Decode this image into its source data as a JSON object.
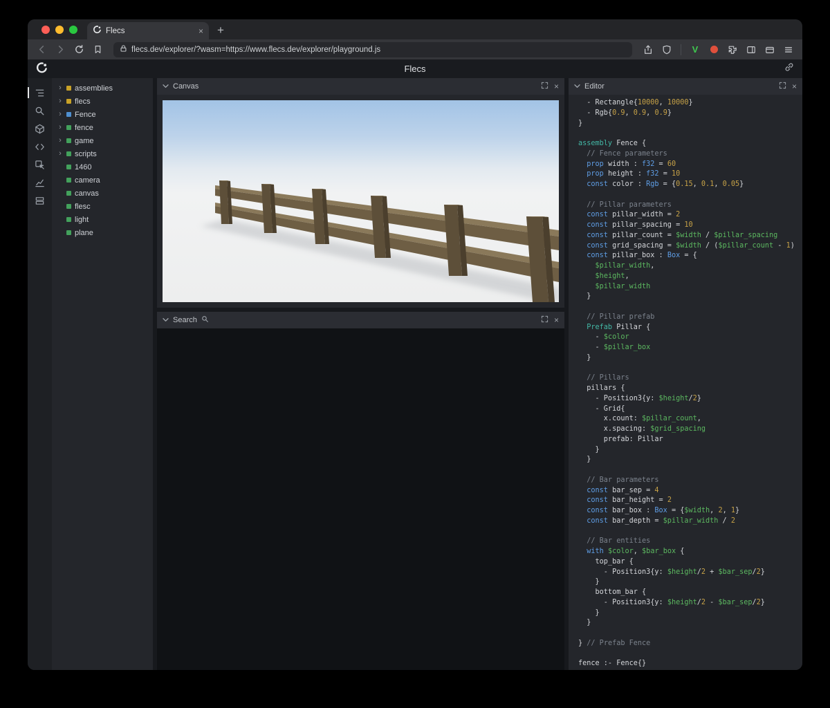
{
  "browser": {
    "tab_title": "Flecs",
    "url": "flecs.dev/explorer/?wasm=https://www.flecs.dev/explorer/playground.js"
  },
  "page": {
    "title": "Flecs"
  },
  "panels": {
    "canvas": {
      "title": "Canvas"
    },
    "search": {
      "title": "Search"
    },
    "editor": {
      "title": "Editor"
    }
  },
  "tree": {
    "type_colors": {
      "module": "#c9a227",
      "prefab": "#4f8fd0",
      "entity": "#43a15c"
    },
    "items": [
      {
        "label": "assemblies",
        "type": "module",
        "expandable": true
      },
      {
        "label": "flecs",
        "type": "module",
        "expandable": true
      },
      {
        "label": "Fence",
        "type": "prefab",
        "expandable": true
      },
      {
        "label": "fence",
        "type": "entity",
        "expandable": true
      },
      {
        "label": "game",
        "type": "entity",
        "expandable": true
      },
      {
        "label": "scripts",
        "type": "entity",
        "expandable": true
      },
      {
        "label": "1460",
        "type": "entity",
        "expandable": false
      },
      {
        "label": "camera",
        "type": "entity",
        "expandable": false
      },
      {
        "label": "canvas",
        "type": "entity",
        "expandable": false
      },
      {
        "label": "flesc",
        "type": "entity",
        "expandable": false
      },
      {
        "label": "light",
        "type": "entity",
        "expandable": false
      },
      {
        "label": "plane",
        "type": "entity",
        "expandable": false
      }
    ]
  },
  "editor": {
    "token_colors": {
      "k": "#5f9ee6",
      "a": "#43b8a6",
      "t": "#5f9ee6",
      "v": "#5cb860",
      "n": "#c7a247",
      "c": "#7b828c",
      "p": "#d4d6da"
    },
    "lines": [
      [
        [
          "p",
          "  - Rectangle{"
        ],
        [
          "n",
          "10000"
        ],
        [
          "p",
          ", "
        ],
        [
          "n",
          "10000"
        ],
        [
          "p",
          "}"
        ]
      ],
      [
        [
          "p",
          "  - Rgb{"
        ],
        [
          "n",
          "0.9"
        ],
        [
          "p",
          ", "
        ],
        [
          "n",
          "0.9"
        ],
        [
          "p",
          ", "
        ],
        [
          "n",
          "0.9"
        ],
        [
          "p",
          "}"
        ]
      ],
      [
        [
          "p",
          "}"
        ]
      ],
      [],
      [
        [
          "a",
          "assembly"
        ],
        [
          "p",
          " Fence {"
        ]
      ],
      [
        [
          "c",
          "  // Fence parameters"
        ]
      ],
      [
        [
          "k",
          "  prop"
        ],
        [
          "p",
          " width : "
        ],
        [
          "t",
          "f32"
        ],
        [
          "p",
          " = "
        ],
        [
          "n",
          "60"
        ]
      ],
      [
        [
          "k",
          "  prop"
        ],
        [
          "p",
          " height : "
        ],
        [
          "t",
          "f32"
        ],
        [
          "p",
          " = "
        ],
        [
          "n",
          "10"
        ]
      ],
      [
        [
          "k",
          "  const"
        ],
        [
          "p",
          " color : "
        ],
        [
          "t",
          "Rgb"
        ],
        [
          "p",
          " = {"
        ],
        [
          "n",
          "0.15"
        ],
        [
          "p",
          ", "
        ],
        [
          "n",
          "0.1"
        ],
        [
          "p",
          ", "
        ],
        [
          "n",
          "0.05"
        ],
        [
          "p",
          "}"
        ]
      ],
      [],
      [
        [
          "c",
          "  // Pillar parameters"
        ]
      ],
      [
        [
          "k",
          "  const"
        ],
        [
          "p",
          " pillar_width = "
        ],
        [
          "n",
          "2"
        ]
      ],
      [
        [
          "k",
          "  const"
        ],
        [
          "p",
          " pillar_spacing = "
        ],
        [
          "n",
          "10"
        ]
      ],
      [
        [
          "k",
          "  const"
        ],
        [
          "p",
          " pillar_count = "
        ],
        [
          "v",
          "$width"
        ],
        [
          "p",
          " / "
        ],
        [
          "v",
          "$pillar_spacing"
        ]
      ],
      [
        [
          "k",
          "  const"
        ],
        [
          "p",
          " grid_spacing = "
        ],
        [
          "v",
          "$width"
        ],
        [
          "p",
          " / ("
        ],
        [
          "v",
          "$pillar_count"
        ],
        [
          "p",
          " - "
        ],
        [
          "n",
          "1"
        ],
        [
          "p",
          ")"
        ]
      ],
      [
        [
          "k",
          "  const"
        ],
        [
          "p",
          " pillar_box : "
        ],
        [
          "t",
          "Box"
        ],
        [
          "p",
          " = {"
        ]
      ],
      [
        [
          "p",
          "    "
        ],
        [
          "v",
          "$pillar_width"
        ],
        [
          "p",
          ","
        ]
      ],
      [
        [
          "p",
          "    "
        ],
        [
          "v",
          "$height"
        ],
        [
          "p",
          ","
        ]
      ],
      [
        [
          "p",
          "    "
        ],
        [
          "v",
          "$pillar_width"
        ]
      ],
      [
        [
          "p",
          "  }"
        ]
      ],
      [],
      [
        [
          "c",
          "  // Pillar prefab"
        ]
      ],
      [
        [
          "a",
          "  Prefab"
        ],
        [
          "p",
          " Pillar {"
        ]
      ],
      [
        [
          "p",
          "    - "
        ],
        [
          "v",
          "$color"
        ]
      ],
      [
        [
          "p",
          "    - "
        ],
        [
          "v",
          "$pillar_box"
        ]
      ],
      [
        [
          "p",
          "  }"
        ]
      ],
      [],
      [
        [
          "c",
          "  // Pillars"
        ]
      ],
      [
        [
          "p",
          "  pillars {"
        ]
      ],
      [
        [
          "p",
          "    - Position3{y: "
        ],
        [
          "v",
          "$height"
        ],
        [
          "p",
          "/"
        ],
        [
          "n",
          "2"
        ],
        [
          "p",
          "}"
        ]
      ],
      [
        [
          "p",
          "    - Grid{"
        ]
      ],
      [
        [
          "p",
          "      x.count: "
        ],
        [
          "v",
          "$pillar_count"
        ],
        [
          "p",
          ","
        ]
      ],
      [
        [
          "p",
          "      x.spacing: "
        ],
        [
          "v",
          "$grid_spacing"
        ]
      ],
      [
        [
          "p",
          "      prefab: Pillar"
        ]
      ],
      [
        [
          "p",
          "    }"
        ]
      ],
      [
        [
          "p",
          "  }"
        ]
      ],
      [],
      [
        [
          "c",
          "  // Bar parameters"
        ]
      ],
      [
        [
          "k",
          "  const"
        ],
        [
          "p",
          " bar_sep = "
        ],
        [
          "n",
          "4"
        ]
      ],
      [
        [
          "k",
          "  const"
        ],
        [
          "p",
          " bar_height = "
        ],
        [
          "n",
          "2"
        ]
      ],
      [
        [
          "k",
          "  const"
        ],
        [
          "p",
          " bar_box : "
        ],
        [
          "t",
          "Box"
        ],
        [
          "p",
          " = {"
        ],
        [
          "v",
          "$width"
        ],
        [
          "p",
          ", "
        ],
        [
          "n",
          "2"
        ],
        [
          "p",
          ", "
        ],
        [
          "n",
          "1"
        ],
        [
          "p",
          "}"
        ]
      ],
      [
        [
          "k",
          "  const"
        ],
        [
          "p",
          " bar_depth = "
        ],
        [
          "v",
          "$pillar_width"
        ],
        [
          "p",
          " / "
        ],
        [
          "n",
          "2"
        ]
      ],
      [],
      [
        [
          "c",
          "  // Bar entities"
        ]
      ],
      [
        [
          "k",
          "  with"
        ],
        [
          "p",
          " "
        ],
        [
          "v",
          "$color"
        ],
        [
          "p",
          ", "
        ],
        [
          "v",
          "$bar_box"
        ],
        [
          "p",
          " {"
        ]
      ],
      [
        [
          "p",
          "    top_bar {"
        ]
      ],
      [
        [
          "p",
          "      - Position3{y: "
        ],
        [
          "v",
          "$height"
        ],
        [
          "p",
          "/"
        ],
        [
          "n",
          "2"
        ],
        [
          "p",
          " + "
        ],
        [
          "v",
          "$bar_sep"
        ],
        [
          "p",
          "/"
        ],
        [
          "n",
          "2"
        ],
        [
          "p",
          "}"
        ]
      ],
      [
        [
          "p",
          "    }"
        ]
      ],
      [
        [
          "p",
          "    bottom_bar {"
        ]
      ],
      [
        [
          "p",
          "      - Position3{y: "
        ],
        [
          "v",
          "$height"
        ],
        [
          "p",
          "/"
        ],
        [
          "n",
          "2"
        ],
        [
          "p",
          " - "
        ],
        [
          "v",
          "$bar_sep"
        ],
        [
          "p",
          "/"
        ],
        [
          "n",
          "2"
        ],
        [
          "p",
          "}"
        ]
      ],
      [
        [
          "p",
          "    }"
        ]
      ],
      [
        [
          "p",
          "  }"
        ]
      ],
      [],
      [
        [
          "p",
          "} "
        ],
        [
          "c",
          "// Prefab Fence"
        ]
      ],
      [],
      [
        [
          "p",
          "fence :- Fence{}"
        ]
      ]
    ]
  }
}
